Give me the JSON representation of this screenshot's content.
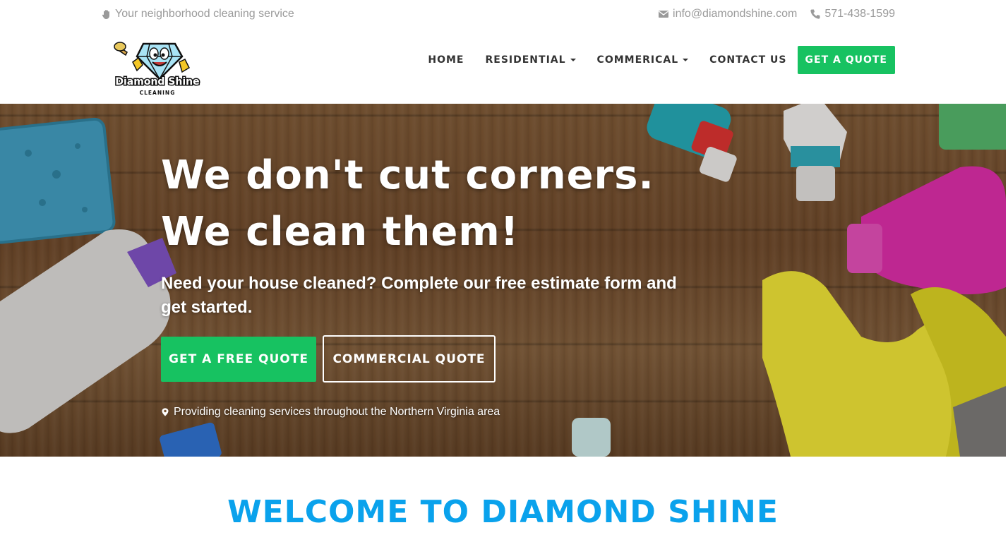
{
  "topbar": {
    "tagline": "Your neighborhood cleaning service",
    "tagline_icon": "hand-icon",
    "email": "info@diamondshine.com",
    "email_icon": "envelope-icon",
    "phone": "571-438-1599",
    "phone_icon": "phone-icon"
  },
  "header": {
    "logo": {
      "name": "Diamond Shine",
      "sub": "CLEANING"
    },
    "nav": [
      {
        "label": "HOME",
        "dropdown": false
      },
      {
        "label": "RESIDENTIAL",
        "dropdown": true
      },
      {
        "label": "COMMERICAL",
        "dropdown": true
      },
      {
        "label": "CONTACT US",
        "dropdown": false
      }
    ],
    "quote_button": "GET A QUOTE"
  },
  "hero": {
    "headline_line1": "We don't cut corners.",
    "headline_line2": "We clean them!",
    "subhead": "Need your house cleaned? Complete our free estimate form and get started.",
    "primary_cta": "GET A FREE QUOTE",
    "secondary_cta": "COMMERCIAL QUOTE",
    "service_area": "Providing cleaning services throughout the Northern Virginia area",
    "service_area_icon": "map-marker-icon"
  },
  "welcome": {
    "title": "WELCOME TO DIAMOND SHINE"
  },
  "colors": {
    "accent_green": "#17c261",
    "welcome_blue": "#0aa2ec",
    "nav_text": "#333333",
    "muted_text": "#9a9a9a"
  }
}
